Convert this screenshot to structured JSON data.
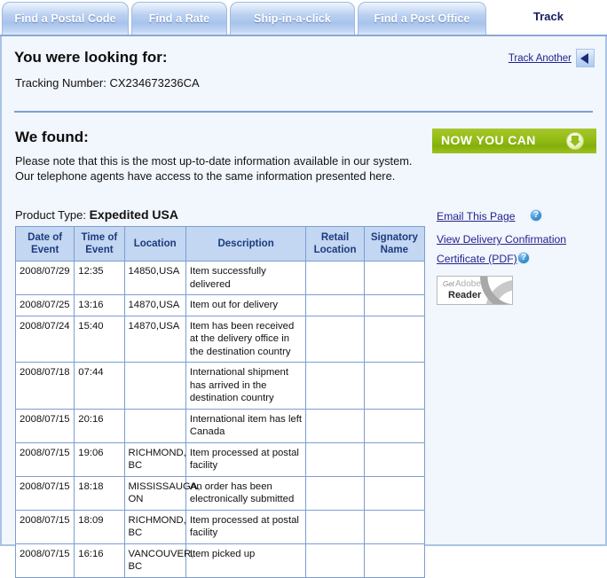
{
  "tabs": {
    "items": [
      {
        "label": "Find a Postal Code"
      },
      {
        "label": "Find a Rate"
      },
      {
        "label": "Ship-in-a-click"
      },
      {
        "label": "Find a Post Office"
      }
    ],
    "active_label": "Track"
  },
  "looking_for": {
    "heading": "You were looking for:",
    "tracking_label": "Tracking Number: CX234673236CA",
    "track_another_link": "Track Another",
    "back_icon": "back-arrow-icon"
  },
  "found": {
    "heading": "We found:",
    "note": "Please note that this is the most up-to-date information available in our system. Our telephone agents have access to the same information presented here.",
    "product_type_label": "Product Type: ",
    "product_type_value": "Expedited USA"
  },
  "sidebar": {
    "banner_title": "NOW YOU CAN",
    "banner_icon": "download-arrow-icon",
    "banner_color": "#93bb15",
    "links": [
      {
        "label": "Email This Page",
        "help_icon": "help-question-icon"
      },
      {
        "label": "View Delivery Confirmation"
      },
      {
        "label": "Certificate (PDF)",
        "help_icon": "help-question-icon"
      }
    ],
    "adobe": {
      "get": "Get",
      "name": "Adobe",
      "reader": "Reader"
    }
  },
  "table": {
    "columns": [
      "Date of Event",
      "Time of Event",
      "Location",
      "Description",
      "Retail Location",
      "Signatory Name"
    ],
    "rows": [
      {
        "date": "2008/07/29",
        "time": "12:35",
        "location": "14850,USA",
        "description": "Item successfully delivered",
        "retail": "",
        "signatory": ""
      },
      {
        "date": "2008/07/25",
        "time": "13:16",
        "location": "14870,USA",
        "description": "Item out for delivery",
        "retail": "",
        "signatory": ""
      },
      {
        "date": "2008/07/24",
        "time": "15:40",
        "location": "14870,USA",
        "description": "Item has been received at the delivery office in the destination country",
        "retail": "",
        "signatory": ""
      },
      {
        "date": "2008/07/18",
        "time": "07:44",
        "location": "",
        "description": "International shipment has arrived in the destination country",
        "retail": "",
        "signatory": ""
      },
      {
        "date": "2008/07/15",
        "time": "20:16",
        "location": "",
        "description": "International item has left Canada",
        "retail": "",
        "signatory": ""
      },
      {
        "date": "2008/07/15",
        "time": "19:06",
        "location": "RICHMOND, BC",
        "description": "Item processed at postal facility",
        "retail": "",
        "signatory": ""
      },
      {
        "date": "2008/07/15",
        "time": "18:18",
        "location": "MISSISSAUGA, ON",
        "description": "An order has been electronically submitted",
        "retail": "",
        "signatory": ""
      },
      {
        "date": "2008/07/15",
        "time": "18:09",
        "location": "RICHMOND, BC",
        "description": "Item processed at postal facility",
        "retail": "",
        "signatory": ""
      },
      {
        "date": "2008/07/15",
        "time": "16:16",
        "location": "VANCOUVER, BC",
        "description": "Item picked up",
        "retail": "",
        "signatory": ""
      }
    ]
  }
}
